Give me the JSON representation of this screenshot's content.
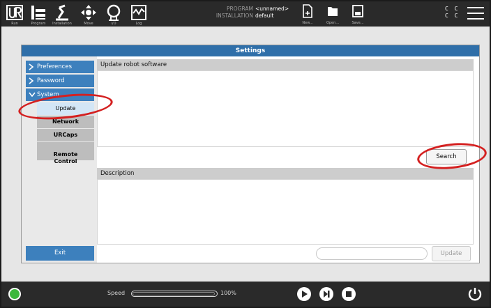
{
  "toolbar": {
    "buttons": [
      {
        "label": "Run",
        "icon": "ur-logo-icon"
      },
      {
        "label": "Program",
        "icon": "program-icon"
      },
      {
        "label": "Installation",
        "icon": "installation-icon"
      },
      {
        "label": "Move",
        "icon": "move-icon"
      },
      {
        "label": "I/O",
        "icon": "io-icon"
      },
      {
        "label": "Log",
        "icon": "log-icon"
      }
    ],
    "program_key": "PROGRAM",
    "program_value": "<unnamed>",
    "installation_key": "INSTALLATION",
    "installation_value": "default",
    "file_buttons": [
      {
        "label": "New...",
        "icon": "new-file-icon"
      },
      {
        "label": "Open...",
        "icon": "folder-icon"
      },
      {
        "label": "Save...",
        "icon": "save-icon"
      }
    ],
    "cc_line1": "C C",
    "cc_line2": "C C",
    "menu_icon": "hamburger-menu-icon"
  },
  "settings": {
    "title": "Settings",
    "sidebar": {
      "items": [
        {
          "label": "Preferences",
          "expanded": false
        },
        {
          "label": "Password",
          "expanded": false
        },
        {
          "label": "System",
          "expanded": true
        }
      ],
      "sub_items": [
        {
          "label": "Update",
          "active": true
        },
        {
          "label": "Network",
          "active": false
        },
        {
          "label": "URCaps",
          "active": false
        },
        {
          "label": "Remote\nControl",
          "active": false
        }
      ],
      "exit_label": "Exit"
    },
    "update_section": {
      "header": "Update robot software",
      "search_label": "Search"
    },
    "description_section": {
      "header": "Description",
      "update_label": "Update",
      "update_field_value": ""
    }
  },
  "footer": {
    "speed_label": "Speed",
    "speed_value": "100%",
    "speed_fraction": 1.0,
    "status_color": "#3cb73c",
    "controls": [
      "play-icon",
      "step-icon",
      "stop-icon"
    ],
    "power_icon": "power-icon"
  },
  "colors": {
    "accent": "#3d80bd",
    "title_bar": "#2f6fa9",
    "toolbar": "#2a2a2a",
    "annotation": "#d42020"
  }
}
